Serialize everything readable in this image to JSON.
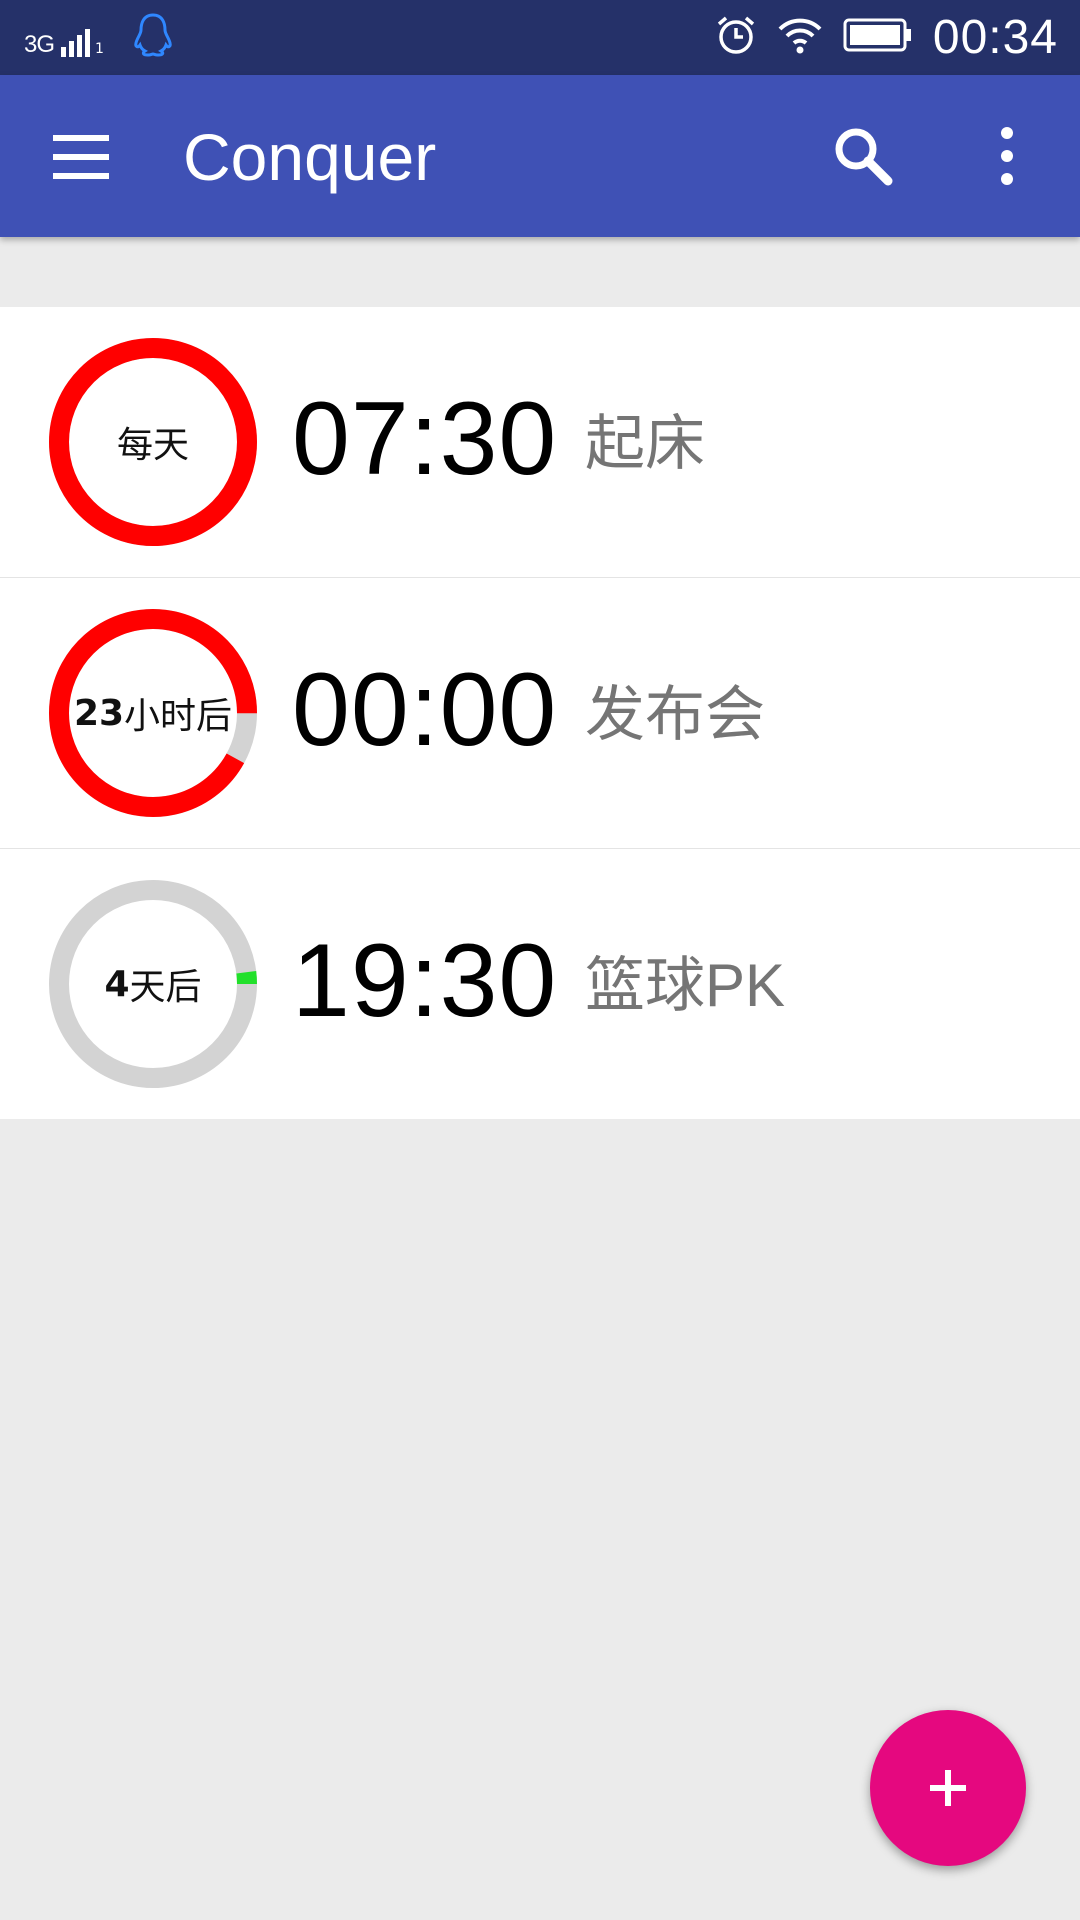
{
  "status_bar": {
    "network_type": "3G",
    "sim_index": "1",
    "qq_icon": "qq-penguin-icon",
    "alarm_icon": "alarm-clock-icon",
    "wifi_icon": "wifi-icon",
    "battery_icon": "battery-icon",
    "time": "00:34"
  },
  "app_bar": {
    "title": "Conquer",
    "menu_icon": "hamburger-menu-icon",
    "search_icon": "search-icon",
    "more_icon": "more-vert-icon",
    "color": "#3f51b5"
  },
  "alarms": [
    {
      "ring_label": "每天",
      "time": "07:30",
      "name": "起床",
      "progress": 1.0,
      "progress_color": "#ff0000"
    },
    {
      "ring_label_num": "23",
      "ring_label_unit": "小时后",
      "time": "00:00",
      "name": "发布会",
      "progress": 0.92,
      "progress_color": "#ff0000"
    },
    {
      "ring_label_num": "4",
      "ring_label_unit": "天后",
      "time": "19:30",
      "name": "篮球PK",
      "progress": 0.02,
      "progress_color": "#22e02b"
    }
  ],
  "fab": {
    "label": "+",
    "icon": "add-icon",
    "color": "#e5087f"
  },
  "colors": {
    "status_bar": "#253169",
    "ring_track": "#d3d3d3",
    "background": "#ebebeb"
  }
}
